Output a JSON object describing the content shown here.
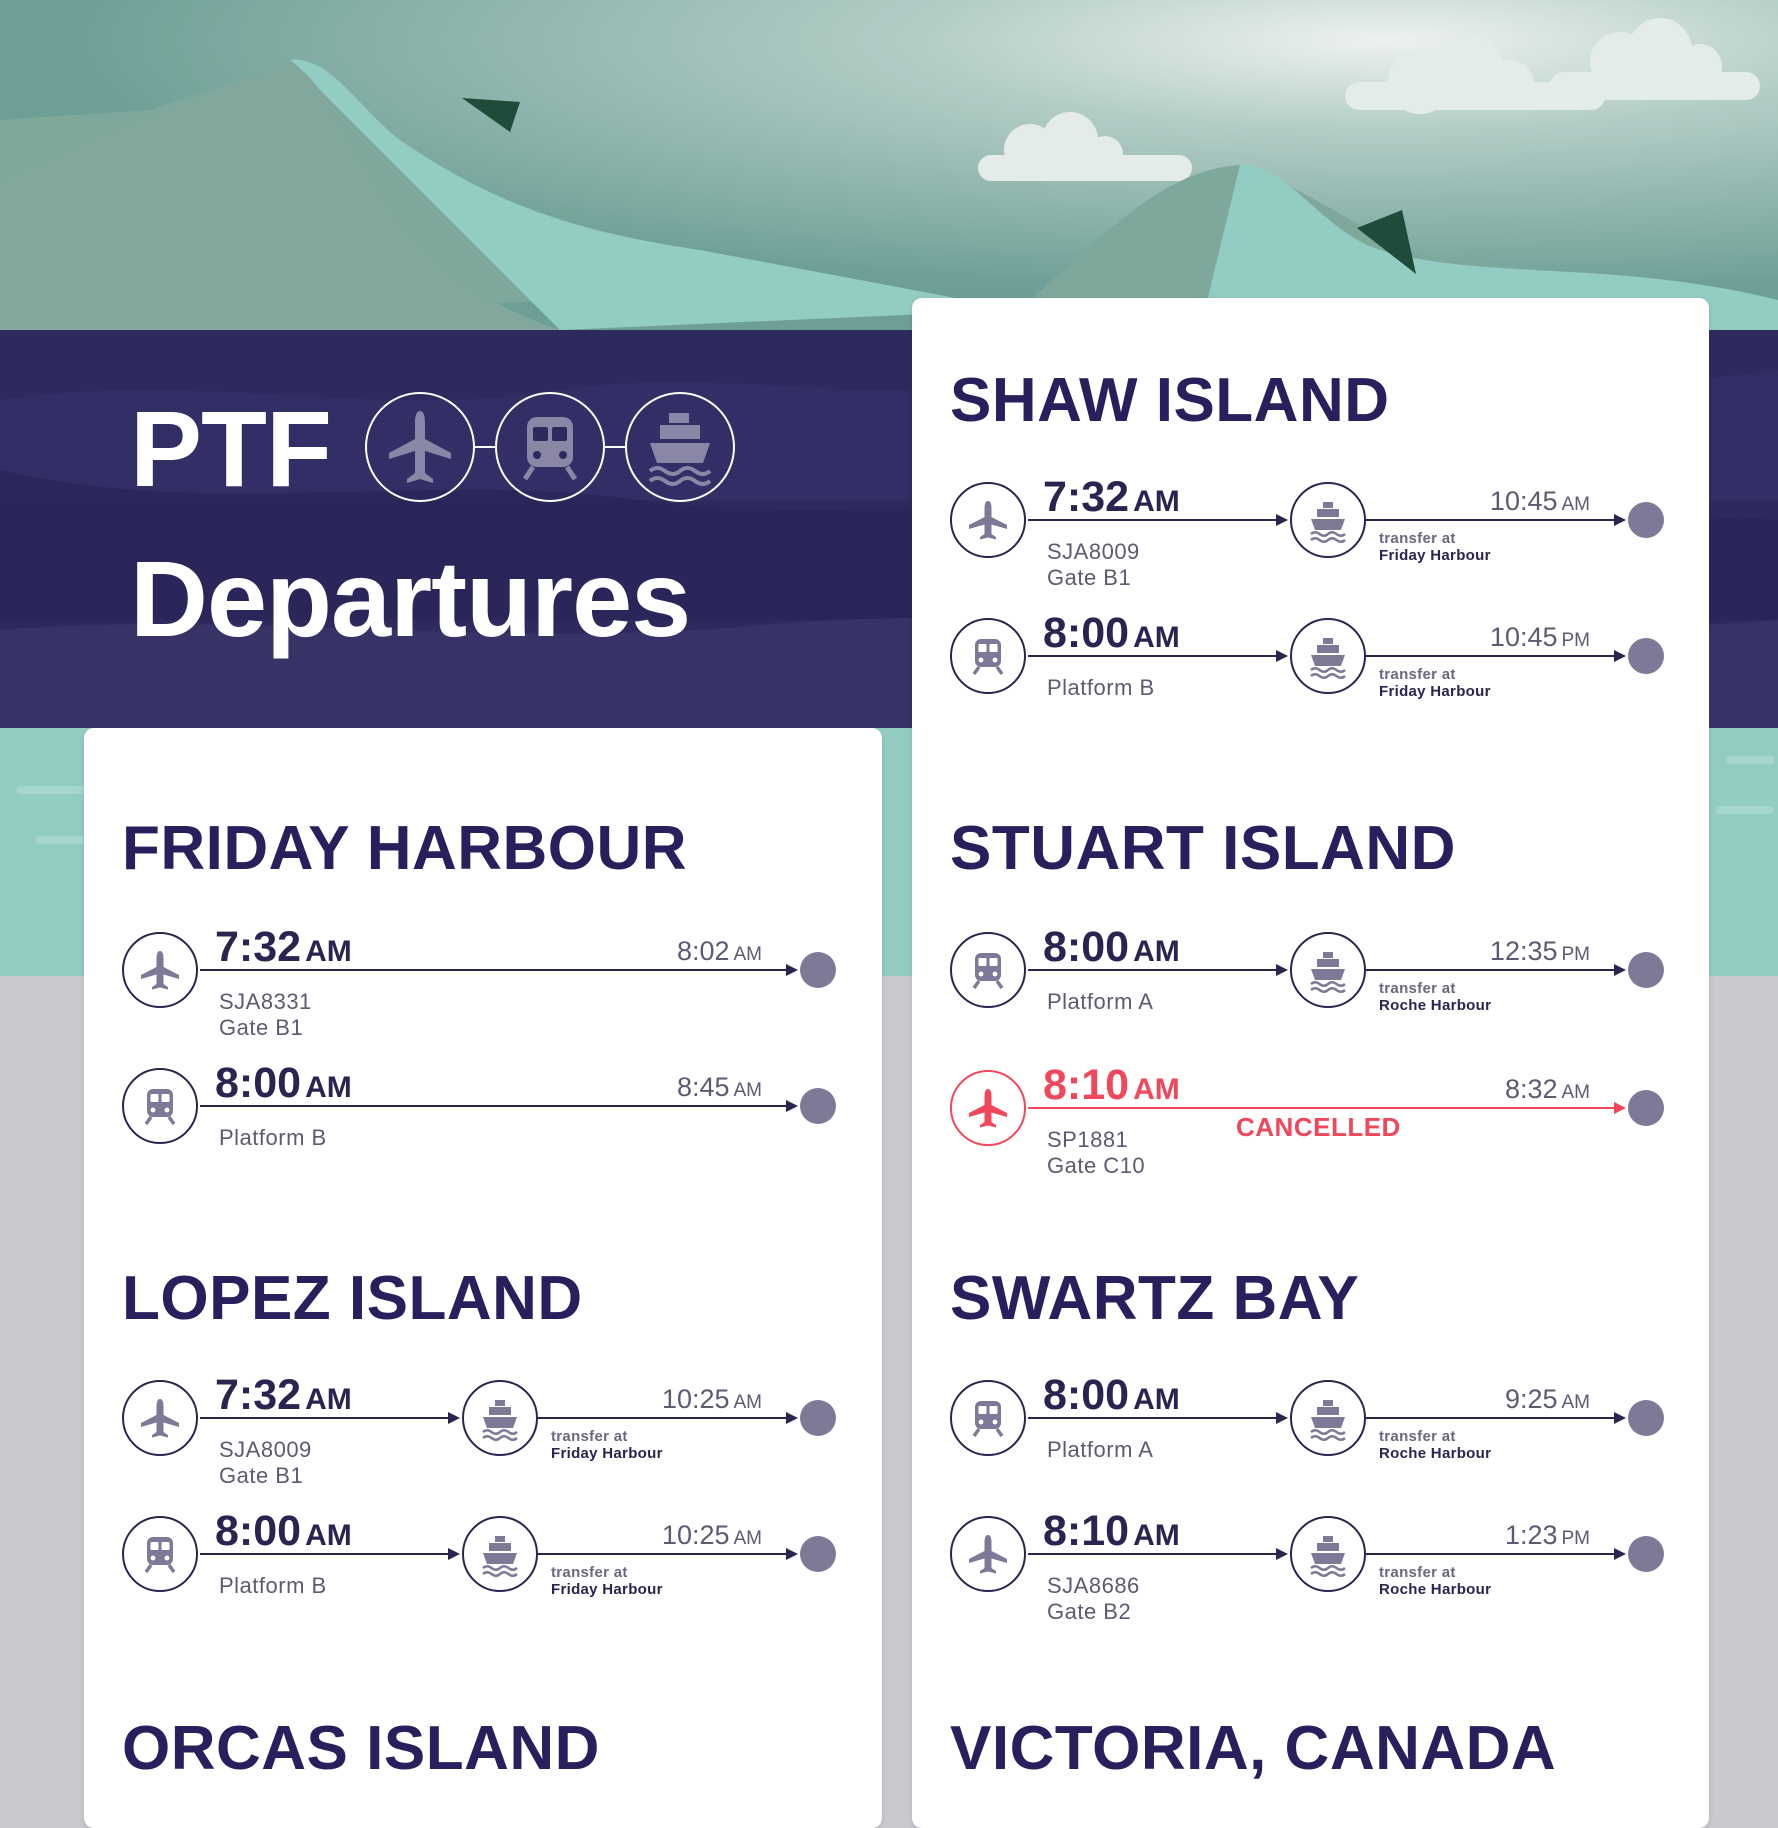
{
  "header": {
    "title_line1": "PTF",
    "title_line2": "Departures",
    "mode_icons": [
      "plane-icon",
      "train-icon",
      "ferry-icon"
    ]
  },
  "colors": {
    "navy": "#2c2350",
    "mint": "#93ccc2",
    "band": "#2e2a5e",
    "cancel_red": "#f0475c",
    "dot": "#7d7a98"
  },
  "destinations": [
    {
      "name": "FRIDAY HARBOUR",
      "trips": [
        {
          "mode": "plane-icon",
          "time": "7:32",
          "ampm": "AM",
          "sub1": "SJA8331",
          "sub2": "Gate B1",
          "arrive": "8:02",
          "arrive_ampm": "AM"
        },
        {
          "mode": "train-icon",
          "time": "8:00",
          "ampm": "AM",
          "sub1": "Platform B",
          "arrive": "8:45",
          "arrive_ampm": "AM"
        }
      ]
    },
    {
      "name": "LOPEZ ISLAND",
      "trips": [
        {
          "mode": "plane-icon",
          "time": "7:32",
          "ampm": "AM",
          "sub1": "SJA8009",
          "sub2": "Gate B1",
          "transfer_label": "transfer at",
          "transfer_place": "Friday Harbour",
          "arrive": "10:25",
          "arrive_ampm": "AM"
        },
        {
          "mode": "train-icon",
          "time": "8:00",
          "ampm": "AM",
          "sub1": "Platform B",
          "transfer_label": "transfer at",
          "transfer_place": "Friday Harbour",
          "arrive": "10:25",
          "arrive_ampm": "AM"
        }
      ]
    },
    {
      "name": "ORCAS ISLAND",
      "trips": []
    },
    {
      "name": "SHAW ISLAND",
      "trips": [
        {
          "mode": "plane-icon",
          "time": "7:32",
          "ampm": "AM",
          "sub1": "SJA8009",
          "sub2": "Gate B1",
          "transfer_label": "transfer at",
          "transfer_place": "Friday Harbour",
          "arrive": "10:45",
          "arrive_ampm": "AM"
        },
        {
          "mode": "train-icon",
          "time": "8:00",
          "ampm": "AM",
          "sub1": "Platform B",
          "transfer_label": "transfer at",
          "transfer_place": "Friday Harbour",
          "arrive": "10:45",
          "arrive_ampm": "PM"
        }
      ]
    },
    {
      "name": "STUART ISLAND",
      "trips": [
        {
          "mode": "train-icon",
          "time": "8:00",
          "ampm": "AM",
          "sub1": "Platform A",
          "transfer_label": "transfer at",
          "transfer_place": "Roche Harbour",
          "arrive": "12:35",
          "arrive_ampm": "PM"
        },
        {
          "mode": "plane-icon",
          "time": "8:10",
          "ampm": "AM",
          "sub1": "SP1881",
          "sub2": "Gate C10",
          "status": "CANCELLED",
          "arrive": "8:32",
          "arrive_ampm": "AM"
        }
      ]
    },
    {
      "name": "SWARTZ BAY",
      "trips": [
        {
          "mode": "train-icon",
          "time": "8:00",
          "ampm": "AM",
          "sub1": "Platform A",
          "transfer_label": "transfer at",
          "transfer_place": "Roche Harbour",
          "arrive": "9:25",
          "arrive_ampm": "AM"
        },
        {
          "mode": "plane-icon",
          "time": "8:10",
          "ampm": "AM",
          "sub1": "SJA8686",
          "sub2": "Gate B2",
          "transfer_label": "transfer at",
          "transfer_place": "Roche Harbour",
          "arrive": "1:23",
          "arrive_ampm": "PM"
        }
      ]
    },
    {
      "name": "VICTORIA, CANADA",
      "trips": []
    }
  ]
}
